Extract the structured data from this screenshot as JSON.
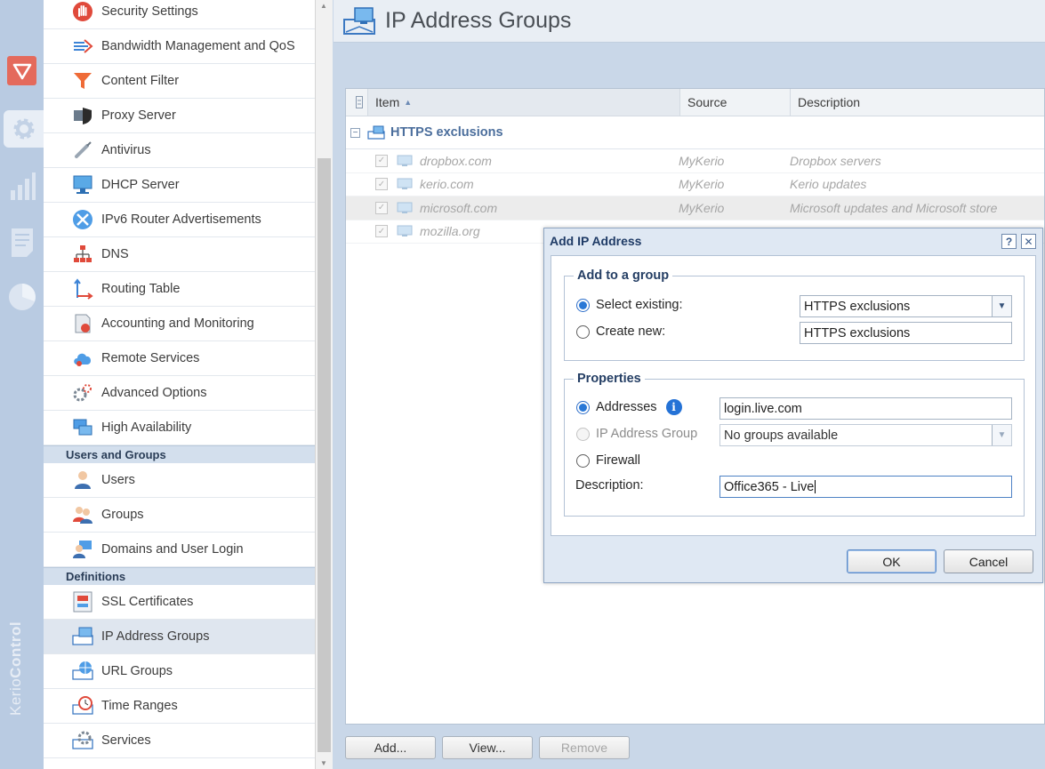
{
  "app": {
    "brand_light": "Kerio",
    "brand_bold": "Control"
  },
  "rail": [
    {
      "name": "security",
      "icon": "shield-icon"
    },
    {
      "name": "settings",
      "icon": "gear-icon"
    },
    {
      "name": "statistics",
      "icon": "bar-chart-icon"
    },
    {
      "name": "logs",
      "icon": "document-icon"
    },
    {
      "name": "status",
      "icon": "pie-chart-icon"
    }
  ],
  "nav": {
    "items_top": [
      {
        "label": "Security Settings",
        "icon": "stop-hand-icon"
      },
      {
        "label": "Bandwidth Management and QoS",
        "icon": "bandwidth-icon"
      },
      {
        "label": "Content Filter",
        "icon": "funnel-icon"
      },
      {
        "label": "Proxy Server",
        "icon": "proxy-shield-icon"
      },
      {
        "label": "Antivirus",
        "icon": "syringe-icon"
      },
      {
        "label": "DHCP Server",
        "icon": "dhcp-monitor-icon"
      },
      {
        "label": "IPv6 Router Advertisements",
        "icon": "ipv6-router-icon"
      },
      {
        "label": "DNS",
        "icon": "dns-tree-icon"
      },
      {
        "label": "Routing Table",
        "icon": "routing-arrows-icon"
      },
      {
        "label": "Accounting and Monitoring",
        "icon": "accounting-icon"
      },
      {
        "label": "Remote Services",
        "icon": "cloud-icon"
      },
      {
        "label": "Advanced Options",
        "icon": "gears-icon"
      },
      {
        "label": "High Availability",
        "icon": "cluster-icon"
      }
    ],
    "section_users": "Users and Groups",
    "items_users": [
      {
        "label": "Users",
        "icon": "user-icon"
      },
      {
        "label": "Groups",
        "icon": "group-icon"
      },
      {
        "label": "Domains and User Login",
        "icon": "domain-user-icon"
      }
    ],
    "section_defs": "Definitions",
    "items_defs": [
      {
        "label": "SSL Certificates",
        "icon": "certificate-icon"
      },
      {
        "label": "IP Address Groups",
        "icon": "ip-group-icon"
      },
      {
        "label": "URL Groups",
        "icon": "url-globe-icon"
      },
      {
        "label": "Time Ranges",
        "icon": "clock-icon"
      },
      {
        "label": "Services",
        "icon": "service-gear-icon"
      }
    ]
  },
  "page": {
    "title": "IP Address Groups"
  },
  "grid": {
    "columns": {
      "item": "Item",
      "source": "Source",
      "description": "Description"
    },
    "group": "HTTPS exclusions",
    "rows": [
      {
        "item": "dropbox.com",
        "source": "MyKerio",
        "description": "Dropbox servers"
      },
      {
        "item": "kerio.com",
        "source": "MyKerio",
        "description": "Kerio updates"
      },
      {
        "item": "microsoft.com",
        "source": "MyKerio",
        "description": "Microsoft updates and Microsoft store"
      },
      {
        "item": "mozilla.org",
        "source": "",
        "description": ""
      }
    ]
  },
  "buttons": {
    "add": "Add...",
    "view": "View...",
    "remove": "Remove"
  },
  "dialog": {
    "title": "Add IP Address",
    "help": "?",
    "close": "✕",
    "group_legend": "Add to a group",
    "select_existing_label": "Select existing:",
    "select_existing_value": "HTTPS exclusions",
    "create_new_label": "Create new:",
    "create_new_value": "HTTPS exclusions",
    "props_legend": "Properties",
    "addresses_label": "Addresses",
    "addresses_value": "login.live.com",
    "ip_group_label": "IP Address Group",
    "ip_group_value": "No groups available",
    "firewall_label": "Firewall",
    "description_label": "Description:",
    "description_value": "Office365 - Live",
    "ok": "OK",
    "cancel": "Cancel"
  }
}
